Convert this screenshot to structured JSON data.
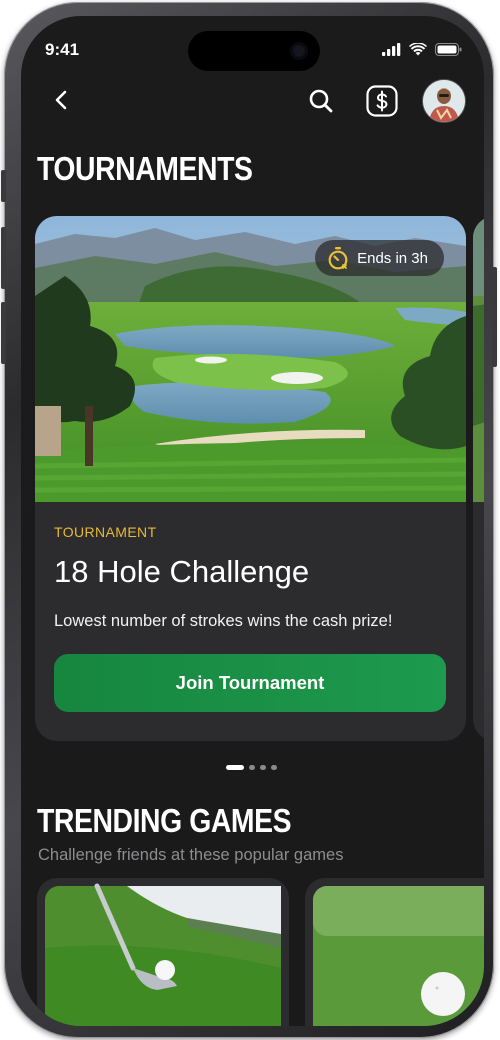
{
  "status_bar": {
    "time": "9:41"
  },
  "nav": {
    "back_icon": "chevron-left-icon",
    "search_icon": "search-icon",
    "wallet_icon": "dollar-icon",
    "avatar": "user-avatar"
  },
  "tournaments": {
    "heading": "TOURNAMENTS",
    "card": {
      "badge": "Ends in 3h",
      "badge_icon": "timer-icon",
      "tag": "TOURNAMENT",
      "title": "18 Hole Challenge",
      "description": "Lowest number of strokes wins the cash prize!",
      "button_label": "Join Tournament"
    },
    "pager": {
      "count": 4,
      "active": 0
    }
  },
  "trending": {
    "heading": "TRENDING GAMES",
    "subtitle": "Challenge friends at these popular games"
  },
  "colors": {
    "background": "#1a1a1b",
    "card": "#2c2c2e",
    "accent_green": "#1a8f45",
    "tag_yellow": "#e7b93a",
    "badge_icon_yellow": "#e8c23c"
  }
}
